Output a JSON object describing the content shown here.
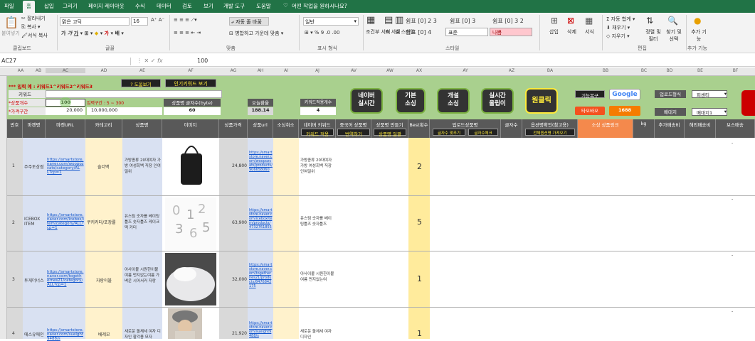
{
  "tabs": [
    "파일",
    "홈",
    "삽입",
    "그리기",
    "페이지 레이아웃",
    "수식",
    "데이터",
    "검토",
    "보기",
    "개발 도구",
    "도움말",
    "어떤 작업을 원하시나요?"
  ],
  "ribbon": {
    "paste": "붙여넣기",
    "cut": "잘라내기",
    "copy": "복사",
    "format_copy": "서식 복사",
    "clipboard": "클립보드",
    "font_name": "맑은 고딕",
    "font_size": "16",
    "font_group": "글꼴",
    "wrap": "자동 줄 바꿈",
    "merge": "병합하고 가운데 맞춤",
    "align_group": "맞춤",
    "num_format": "일반",
    "num_group": "표시 형식",
    "cond_format": "조건부 서식",
    "table_format": "표 서식",
    "cell_styles": "셀 스타일",
    "style_items": [
      "쉼표 [0] 2 3",
      "쉼표 [0] 3",
      "쉼표 [0] 3 2",
      "쉼표 [0] 4",
      "표준",
      "나쁨"
    ],
    "style_group": "스타일",
    "insert": "삽입",
    "delete": "삭제",
    "format": "서식",
    "autosum": "자동 합계",
    "fill": "채우기",
    "clear": "지우기",
    "sort": "정렬 및 필터",
    "find": "찾기 및 선택",
    "edit_group": "편집",
    "addin": "추가 기능",
    "addin_group": "추가 기능"
  },
  "formula": {
    "namebox": "AC27",
    "fx": "fx",
    "value": "100"
  },
  "columns": [
    "AA",
    "AB",
    "AC",
    "AD",
    "AE",
    "AF",
    "AG",
    "AH",
    "AI",
    "AJ",
    "AV",
    "AW",
    "AX",
    "AY",
    "AZ",
    "BA",
    "BB",
    "BC",
    "BD",
    "BE",
    "BF",
    "BG",
    "BH",
    "BI",
    "BJ",
    "BK"
  ],
  "rows": [
    "1",
    "2",
    "3",
    "4"
  ],
  "top": {
    "notice": "*** 입력 예 : 키워드1^키워드2^키워드3",
    "guide_btn": "? 도움보기",
    "popular_btn": "인기키워드 보기",
    "keyword_lbl": "키워드",
    "count_lbl": "*상품개수",
    "count_val": "100",
    "range_hint": "입력구간 : 5 ~ 300",
    "price_lbl": "*가격구간",
    "price_min": "20,000",
    "price_max": "10,000,000",
    "title_len_lbl": "상품명 글자수(byte)",
    "title_len_val": "60",
    "today_lbl": "오늘환율",
    "today_val": "188.14",
    "kw_count_lbl": "키워드적용개수",
    "kw_count_val": "4",
    "btn_naver": "네이버\n실시간",
    "btn_basic": "기본\n소싱",
    "btn_custom": "개설\n소싱",
    "btn_realtime": "실시간\n올립이",
    "btn_oneclick": "원클릭",
    "func_btn": "기능복구",
    "google_btn": "Google",
    "taobao_btn": "타오바오",
    "btn_1688": "1688",
    "upload_lbl": "업로드형식",
    "upload_val": "피센티",
    "ship_lbl": "배대지",
    "ship_val": "배대지1"
  },
  "headers": [
    "번호",
    "마켓명",
    "마켓URL",
    "카테고리",
    "상품명",
    "이미지",
    "상품가격",
    "상품url",
    "소싱취소",
    "네이버 키워드",
    "중국어 상품명",
    "상품명 만들기",
    "Best횟수",
    "업로드상품명",
    "글자수",
    "옵션명확인(참고용)",
    "소싱 상품링크",
    "kg",
    "추가배송비",
    "해외배송비",
    "보스배송"
  ],
  "subbtns": [
    "키워드 적용",
    "번역하기",
    "상품명 일괄",
    "글자수 맞추기",
    "글자수체크",
    "전체옵션명 가져오기"
  ],
  "data": [
    {
      "no": "1",
      "market": "주주토상점",
      "url": "https://smartstore.naver.com/woopozcats/category/ALL?cp=1",
      "cat": "숄더백",
      "name": "가방종류 20대여자 가방 여성회백 직장 인여밀위",
      "price": "24,800",
      "purl": "https://smartstore.naver.com/woopozcats/products/906658060",
      "naver": "가방종류 20대여자 가방 여성회백 직장인여밀위",
      "best": "2"
    },
    {
      "no": "2",
      "market": "ICEBOX ITEM",
      "url": "https://smartstore.naver.com/icebox/item/category/ALL?cp=1",
      "cat": "쿠키커터/포장률",
      "name": "유스팀 숫자를 베이팅틀즈 숫자틀즈 케이크 떡 커터",
      "price": "63,900",
      "purl": "https://smartstore.naver.com/iceboxitem/products/4732761855",
      "naver": "유스팀 숫자를 베이팅틀즈 숫자틀즈",
      "best": "5"
    },
    {
      "no": "3",
      "market": "투게더너스",
      "url": "https://smartstore.naver.com/togethernes21/category/ALL?cp=1",
      "cat": "자랑이불",
      "name": "아사이불 시원한이불 여름 먼지없는여름 가벼운 시어서커 자랑",
      "price": "32,000",
      "purl": "https://smartstore.naver.com/togethernes21/products/8476842175",
      "naver": "아사이불 시원한이불 여름 먼지없는여",
      "best": "1"
    },
    {
      "no": "4",
      "market": "에스유에인",
      "url": "https://smartstore.naver.com/suelght9488/s",
      "cat": "베레모",
      "name": "새로운 돌체세 여자 디자인 할각용 모자",
      "price": "21,920",
      "purl": "https://smartstore.naver.com/suelght9488/s",
      "naver": "새로운 돌체세 여자 디자인",
      "best": "1"
    }
  ],
  "dash": "-"
}
